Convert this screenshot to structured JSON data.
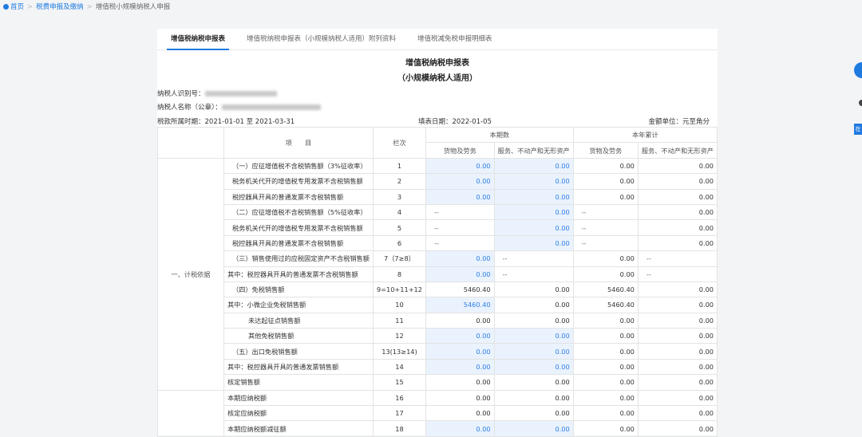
{
  "breadcrumb": {
    "home": "首页",
    "level1": "税费申报及缴纳",
    "current": "增值税小规模纳税人申报"
  },
  "tabs": [
    {
      "label": "增值税纳税申报表"
    },
    {
      "label": "增值税纳税申报表（小规模纳税人适用）附列资料"
    },
    {
      "label": "增值税减免税申报明细表"
    }
  ],
  "title": "增值税纳税申报表",
  "subtitle": "（小规模纳税人适用）",
  "taxpayer": {
    "id_label": "纳税人识别号：",
    "name_label": "纳税人名称（公章）："
  },
  "meta": {
    "period": "税款所属时期：2021-01-01 至 2021-03-31",
    "fill_date": "填表日期：2022-01-05",
    "unit": "金额单位：元至角分"
  },
  "table": {
    "col_item": "项　　目",
    "col_line": "栏次",
    "col_current": "本期数",
    "col_ytd": "本年累计",
    "col_goods": "货物及劳务",
    "col_service": "服务、不动产和无形资产",
    "section1": "一、计税依据",
    "rows": [
      {
        "item": "（一）应征增值税不含税销售额（3%征收率）",
        "line": "1",
        "c1": "0.00",
        "c2": "0.00",
        "c3": "0.00",
        "c4": "0.00",
        "indent": 1
      },
      {
        "item": "税务机关代开的增值税专用发票不含税销售额",
        "line": "2",
        "c1": "0.00",
        "c2": "0.00",
        "c3": "0.00",
        "c4": "0.00",
        "indent": 1
      },
      {
        "item": "税控器具开具的普通发票不含税销售额",
        "line": "3",
        "c1": "0.00",
        "c2": "0.00",
        "c3": "0.00",
        "c4": "0.00",
        "indent": 1
      },
      {
        "item": "（二）应征增值税不含税销售额（5%征收率）",
        "line": "4",
        "c1": "--",
        "c2": "0.00",
        "c3": "--",
        "c4": "0.00",
        "indent": 1
      },
      {
        "item": "税务机关代开的增值税专用发票不含税销售额",
        "line": "5",
        "c1": "--",
        "c2": "0.00",
        "c3": "--",
        "c4": "0.00",
        "indent": 1
      },
      {
        "item": "税控器具开具的普通发票不含税销售额",
        "line": "6",
        "c1": "--",
        "c2": "0.00",
        "c3": "--",
        "c4": "0.00",
        "indent": 1
      },
      {
        "item": "（三）销售使用过的应税固定资产不含税销售额",
        "line": "7（7≥8）",
        "c1": "0.00",
        "c2": "--",
        "c3": "0.00",
        "c4": "--",
        "indent": 1
      },
      {
        "item": "其中：税控器具开具的普通发票不含税销售额",
        "line": "8",
        "c1": "0.00",
        "c2": "--",
        "c3": "0.00",
        "c4": "--",
        "indent": 0
      },
      {
        "item": "（四）免税销售额",
        "line": "9=10+11+12",
        "c1": "5460.40",
        "c2": "0.00",
        "c3": "5460.40",
        "c4": "0.00",
        "indent": 1
      },
      {
        "item": "其中：小微企业免税销售额",
        "line": "10",
        "c1": "5460.40",
        "c2": "0.00",
        "c3": "5460.40",
        "c4": "0.00",
        "indent": 0
      },
      {
        "item": "未达起征点销售额",
        "line": "11",
        "c1": "0.00",
        "c2": "0.00",
        "c3": "0.00",
        "c4": "0.00",
        "indent": 2
      },
      {
        "item": "其他免税销售额",
        "line": "12",
        "c1": "0.00",
        "c2": "0.00",
        "c3": "0.00",
        "c4": "0.00",
        "indent": 2
      },
      {
        "item": "（五）出口免税销售额",
        "line": "13(13≥14)",
        "c1": "0.00",
        "c2": "0.00",
        "c3": "0.00",
        "c4": "0.00",
        "indent": 1
      },
      {
        "item": "其中：税控器具开具的普通发票销售额",
        "line": "14",
        "c1": "0.00",
        "c2": "0.00",
        "c3": "0.00",
        "c4": "0.00",
        "indent": 0
      },
      {
        "item": "核定销售额",
        "line": "15",
        "c1": "0.00",
        "c2": "0.00",
        "c3": "0.00",
        "c4": "0.00",
        "indent": 0
      },
      {
        "item": "本期应纳税额",
        "line": "16",
        "c1": "0.00",
        "c2": "0.00",
        "c3": "0.00",
        "c4": "0.00",
        "indent": 0
      },
      {
        "item": "核定应纳税额",
        "line": "17",
        "c1": "0.00",
        "c2": "0.00",
        "c3": "0.00",
        "c4": "0.00",
        "indent": 0
      },
      {
        "item": "本期应纳税额减征额",
        "line": "18",
        "c1": "0.00",
        "c2": "0.00",
        "c3": "0.00",
        "c4": "0.00",
        "indent": 0
      }
    ]
  },
  "side": {
    "float_btn": "在"
  }
}
